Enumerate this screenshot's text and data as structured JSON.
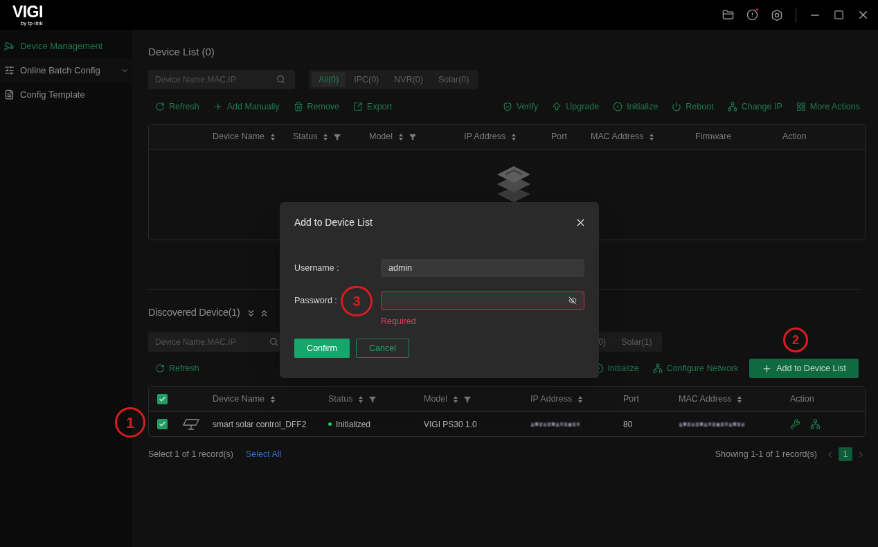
{
  "app": {
    "logo": "VIGI",
    "logo_sub": "by tp-link"
  },
  "sidebar": {
    "items": [
      {
        "label": "Device Management",
        "selected": true,
        "has_submenu": false
      },
      {
        "label": "Online Batch Config",
        "selected": false,
        "has_submenu": true
      },
      {
        "label": "Config Template",
        "selected": false,
        "has_submenu": false
      }
    ]
  },
  "device_list": {
    "title": "Device List (0)",
    "search": {
      "placeholder": "Device Name,MAC,IP"
    },
    "filters": [
      {
        "label": "All(0)",
        "selected": true
      },
      {
        "label": "IPC(0)",
        "selected": false
      },
      {
        "label": "NVR(0)",
        "selected": false
      },
      {
        "label": "Solar(0)",
        "selected": false
      }
    ],
    "actions_left": [
      "Refresh",
      "Add Manually",
      "Remove",
      "Export"
    ],
    "actions_right": [
      "Verify",
      "Upgrade",
      "Initialize",
      "Reboot",
      "Change IP",
      "More Actions"
    ],
    "columns": [
      {
        "label": "Device Name",
        "sortable": true,
        "filterable": false
      },
      {
        "label": "Status",
        "sortable": true,
        "filterable": true
      },
      {
        "label": "Model",
        "sortable": true,
        "filterable": true
      },
      {
        "label": "IP Address",
        "sortable": true,
        "filterable": false
      },
      {
        "label": "Port",
        "sortable": false,
        "filterable": false
      },
      {
        "label": "MAC Address",
        "sortable": true,
        "filterable": false
      },
      {
        "label": "Firmware",
        "sortable": false,
        "filterable": false
      },
      {
        "label": "Action",
        "sortable": false,
        "filterable": false
      }
    ]
  },
  "discovered": {
    "title": "Discovered Device(1)",
    "search": {
      "placeholder": "Device Name,MAC,IP"
    },
    "filters": [
      {
        "label": "0)",
        "selected": false
      },
      {
        "label": "Solar(1)",
        "selected": false
      }
    ],
    "actions_left": [
      "Refresh"
    ],
    "actions_right": [
      "Initialize",
      "Configure Network"
    ],
    "primary_action": "Add to Device List",
    "select_all_checked": true,
    "columns": [
      {
        "label": "Device Name",
        "sortable": true,
        "filterable": false
      },
      {
        "label": "Status",
        "sortable": true,
        "filterable": true
      },
      {
        "label": "Model",
        "sortable": true,
        "filterable": true
      },
      {
        "label": "IP Address",
        "sortable": true,
        "filterable": false
      },
      {
        "label": "Port",
        "sortable": false,
        "filterable": false
      },
      {
        "label": "MAC Address",
        "sortable": true,
        "filterable": false
      },
      {
        "label": "Action",
        "sortable": false,
        "filterable": false
      }
    ],
    "rows": [
      {
        "checked": true,
        "name": "smart solar control_DFF2",
        "status": "Initialized",
        "color": "#22c55e",
        "model": "VIGI PS30 1.0",
        "port": "80"
      }
    ],
    "selection": "Select 1 of 1 record(s)",
    "select_all": "Select All",
    "showing": "Showing 1-1 of 1 record(s)",
    "pages": [
      {
        "label": "1",
        "selected": true
      }
    ]
  },
  "dialog": {
    "title": "Add to Device List",
    "fields": [
      {
        "kind": "text",
        "label": "Username :",
        "value": "admin"
      },
      {
        "kind": "password",
        "label": "Password :",
        "error": "Required"
      }
    ],
    "buttons": [
      {
        "label": "Confirm",
        "kind": "primary"
      },
      {
        "label": "Cancel",
        "kind": "secondary"
      }
    ]
  },
  "annotations": [
    {
      "label": "1"
    },
    {
      "label": "2"
    },
    {
      "label": "3"
    }
  ]
}
